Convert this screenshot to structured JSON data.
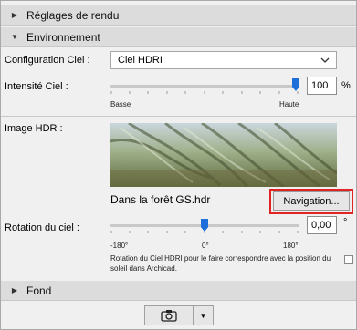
{
  "sections": {
    "render_settings": "Réglages de rendu",
    "environment": "Environnement",
    "background": "Fond"
  },
  "sky_config": {
    "label": "Configuration Ciel :",
    "value": "Ciel HDRI"
  },
  "sky_intensity": {
    "label": "Intensité Ciel :",
    "value": "100",
    "unit": "%",
    "min_label": "Basse",
    "max_label": "Haute",
    "level_fraction": 1.0
  },
  "hdr_image": {
    "label": "Image HDR :",
    "filename": "Dans la forêt GS.hdr",
    "navigation_button": "Navigation..."
  },
  "sky_rotation": {
    "label": "Rotation du ciel :",
    "value": "0,00",
    "unit": "°",
    "tick_min": "-180°",
    "tick_mid": "0°",
    "tick_max": "180°",
    "level_fraction": 0.5,
    "help_text": "Rotation du Ciel HDRI pour le faire correspondre avec la position du soleil dans Archicad."
  },
  "icons": {
    "collapsed": "triangle-right-icon",
    "expanded": "triangle-down-icon",
    "camera": "camera-icon",
    "dropdown": "dropdown-arrow-icon"
  }
}
